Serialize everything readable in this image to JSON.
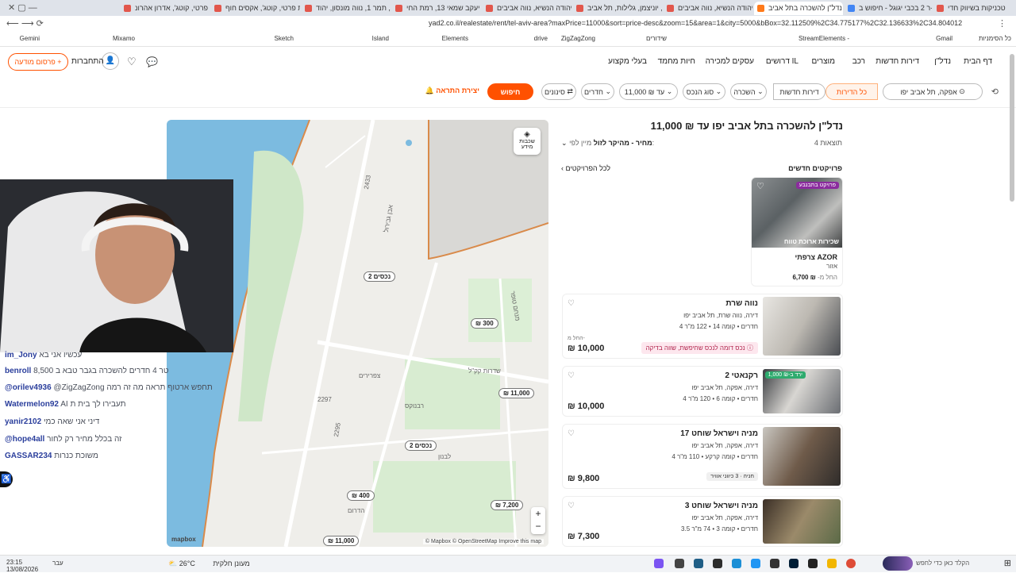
{
  "browser": {
    "tabs": [
      {
        "label": "טכניקות בשיווק חדי - Studio"
      },
      {
        "label": "ר 2 בכבי יגוגל - חיפוש ב-Google"
      },
      {
        "label": "נדל\"ן להשכרה בתל אביב"
      },
      {
        "label": "דירה, יהודה הנשיא, נווה אביבים"
      },
      {
        "label": "דירה, יוניצמן, גלילות, תל אביב"
      },
      {
        "label": "דירה, יהודה הנשיא, נווה אביבים"
      },
      {
        "label": "דירה, יעקב שמאי 13, רמת החי"
      },
      {
        "label": "דירה, תמר 1, נווה מונסון, יהוד"
      },
      {
        "label": "בית פרטי, קוטג', אקסים חוף"
      },
      {
        "label": "בית פרטי, קוטג', אדרון אהרונ"
      }
    ],
    "url": "yad2.co.il/realestate/rent/tel-aviv-area?maxPrice=11000&sort=price-desc&zoom=15&area=1&city=5000&bBox=32.112509%2C34.775177%2C32.136633%2C34.804012",
    "bookmarks": [
      "כל הסימניות",
      "Gmail",
      "StreamElements - ",
      "שידורים",
      "ZigZagZong",
      "drive",
      "Elements",
      "Island",
      "Sketch",
      "Mixamo",
      "Gemini"
    ]
  },
  "site": {
    "nav": [
      "דף הבית",
      "נדל\"ן",
      "דירות חדשות",
      "רכב",
      "מוצרים",
      "דרושים IL",
      "עסקים למכירה",
      "חיות מחמד",
      "בעלי מקצוע"
    ],
    "post_button": "פרסום מודעה",
    "connect_label": "התחברות"
  },
  "filters": {
    "location": "אפקה, תל אביב יפו",
    "segment_all": "כל הדירות",
    "segment_new": "דירות חדשות",
    "rent": "השכרה",
    "property_type": "סוג הנכס",
    "price": "עד ₪ 11,000",
    "rooms": "חדרים",
    "more_filters": "סינונים",
    "search_button": "חיפוש",
    "alert_button": "יצירת התראה"
  },
  "results": {
    "heading": "נדל\"ן להשכרה בתל אביב יפו עד ₪ 11,000",
    "count": "4 תוצאות",
    "sort_label": "מיין לפי:",
    "sort_value": "מחיר - מהיקר לזול",
    "projects_title": "פרויקטים חדשים",
    "all_projects": "לכל הפרויקטים",
    "project": {
      "badge": "פרויקט בתבנבע",
      "banner": "שכירות ארוכת טווח",
      "name": "צרפתי AZOR",
      "city": "אזור",
      "price_prefix": "החל מ-",
      "price": "₪ 6,700"
    },
    "listings": [
      {
        "title": "נווה שרת",
        "subtitle": "דירה, נווה שרת, תל אביב יפו",
        "details": "4 חדרים • קומה 14 • 122 מ\"ר",
        "price": "₪ 10,000",
        "prefix": "החל מ-",
        "badge": "נכס דומה לנכס שחיפשת, שווה בדיקה",
        "tag": "",
        "image_badge": ""
      },
      {
        "title": "רקנאטי 2",
        "subtitle": "דירה, אפקה, תל אביב יפו",
        "details": "4 חדרים • קומה 6 • 120 מ\"ר",
        "price": "₪ 10,000",
        "prefix": "",
        "badge": "",
        "tag": "",
        "image_badge": "ירד ב-₪ 1,000"
      },
      {
        "title": "מניה וישראל שוחט 17",
        "subtitle": "דירה, אפקה, תל אביב יפו",
        "details": "4 חדרים • קומה קרקע • 110 מ\"ר",
        "price": "₪ 9,800",
        "prefix": "",
        "badge": "",
        "tag": "חניה · 3 כיווני אוויר",
        "image_badge": ""
      },
      {
        "title": "מניה וישראל שוחט 3",
        "subtitle": "דירה, אפקה, תל אביב יפו",
        "details": "3.5 חדרים • קומה 3 • 74 מ\"ר",
        "price": "₪ 7,300",
        "prefix": "",
        "badge": "",
        "tag": "",
        "image_badge": ""
      }
    ]
  },
  "map": {
    "layers_button": "שכבות מידע",
    "pins": [
      "2 נכסים",
      "₪ 300",
      "₪ 11,000",
      "2 נכסים",
      "₪ 400",
      "₪ 7,200",
      "₪ 11,000"
    ],
    "street_labels": [
      "2433",
      "2297",
      "2295",
      "אבן גבירול",
      "שדרות קק\"ל",
      "רבנוקס",
      "צפרירים",
      "מנחם טופר",
      "לבנון",
      "הדרום"
    ],
    "attribution": "© Mapbox © OpenStreetMap  Improve this map",
    "logo": "mapbox",
    "zoom_in": "+",
    "zoom_out": "−"
  },
  "stream": {
    "chat": [
      {
        "user": "im_Jony",
        "text": "עכשיו אני בא"
      },
      {
        "user": "benroll",
        "text": "8,500 טר 4 חדרים להשכרה בגבר טבא ב"
      },
      {
        "user": "@orilev4936",
        "text": "@ZigZagZong תחפש ארטוף תראה מה זה רמה"
      },
      {
        "user": "Watermelon92",
        "text": "AI תעבירו לך בית ת"
      },
      {
        "user": "yanir2102",
        "text": "דיני אני שאה כמי"
      },
      {
        "user": "@hope4all",
        "text": "זה בכלל מחיר רק לחור"
      },
      {
        "user": "GASSAR234",
        "text": "משוכת כנרות"
      }
    ]
  },
  "taskbar": {
    "weather": "26°C",
    "weather_text": "מעונן חלקית",
    "time": "23:15",
    "date": "13/08/2026",
    "search_placeholder": "הקלד כאן כדי לחפש",
    "lang": "עבר"
  },
  "colors": {
    "accent": "#ff5100",
    "brand_green": "#31c48d",
    "water": "#6fb4dc"
  }
}
